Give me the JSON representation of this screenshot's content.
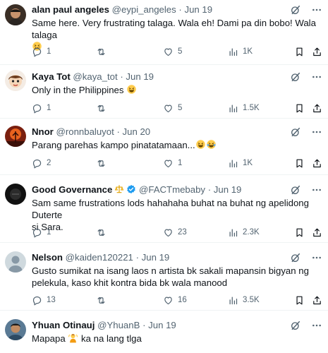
{
  "tweets": [
    {
      "name": "alan paul angeles",
      "handle": "@eypi_angeles",
      "date": "Jun 19",
      "text_lines": [
        "Same here. Very frustrating talaga. Wala eh! Dami pa din bobo! Wala talaga"
      ],
      "text_emoji": "confounded-face",
      "replies": "1",
      "retweets": "",
      "likes": "5",
      "views": "1K"
    },
    {
      "name": "Kaya Tot",
      "handle": "@kaya_tot",
      "date": "Jun 19",
      "text_lines": [
        "Only in the Philippines"
      ],
      "text_emoji": "grinning-squinting-face",
      "replies": "1",
      "retweets": "",
      "likes": "5",
      "views": "1.5K"
    },
    {
      "name": "Nnor",
      "handle": "@ronnbaluyot",
      "date": "Jun 20",
      "text_lines": [
        "Parang parehas kampo pinatatamaan..."
      ],
      "text_emoji": "grinning-squinting-face, crying-laughing-face",
      "replies": "2",
      "retweets": "",
      "likes": "1",
      "views": "1K"
    },
    {
      "name": "Good Governance",
      "handle": "@FACTmebaby",
      "date": "Jun 19",
      "text_lines": [
        "Sam same frustrations lods hahahaha buhat na buhat ng apelidong Duterte",
        "si Sara."
      ],
      "replies": "1",
      "retweets": "",
      "likes": "23",
      "views": "2.3K"
    },
    {
      "name": "Nelson",
      "handle": "@kaiden120221",
      "date": "Jun 19",
      "text_lines": [
        "Gusto sumikat na isang laos n artista bk sakali mapansin bigyan ng",
        "pelekula, kaso khit kontra bida bk wala manood"
      ],
      "replies": "13",
      "retweets": "",
      "likes": "16",
      "views": "3.5K"
    },
    {
      "name": "Yhuan Otinauj",
      "handle": "@YhuanB",
      "date": "Jun 19",
      "text_before": "Mapapa",
      "text_emoji": "person-shrugging",
      "text_after": "ka na lang tlga"
    }
  ],
  "separator": "·",
  "colors": {
    "text": "#0f1419",
    "secondary": "#536471",
    "verified": "#1d9bf0",
    "divider": "#eff3f4"
  },
  "icons": [
    "grok-icon",
    "more-icon",
    "reply-icon",
    "retweet-icon",
    "like-icon",
    "views-icon",
    "bookmark-icon",
    "share-icon",
    "verified-badge-icon",
    "scales-icon"
  ]
}
